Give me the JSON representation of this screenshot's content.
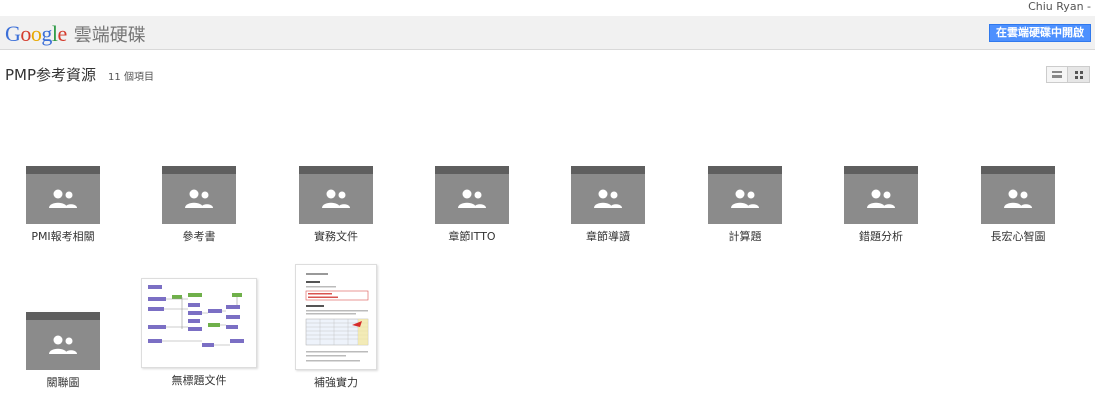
{
  "header": {
    "user_name": "Chiu Ryan -",
    "logo_letters": [
      "G",
      "o",
      "o",
      "g",
      "l",
      "e"
    ],
    "logo_colors": [
      "#3b6fd8",
      "#d43c2d",
      "#e8a800",
      "#3b6fd8",
      "#2f9b46",
      "#d43c2d"
    ],
    "product_name": "雲端硬碟",
    "open_button_label": "在雲端硬碟中開啟",
    "accent_color": "#4d90fe"
  },
  "folder": {
    "title": "PMP参考資源",
    "item_count": "11 個項目"
  },
  "view_toggle": {
    "list_icon": "list-view-icon",
    "grid_icon": "grid-view-icon",
    "active": "grid"
  },
  "items": [
    {
      "type": "shared-folder",
      "label": "PMI報考相關",
      "icon": "shared-folder-icon"
    },
    {
      "type": "shared-folder",
      "label": "參考書",
      "icon": "shared-folder-icon"
    },
    {
      "type": "shared-folder",
      "label": "實務文件",
      "icon": "shared-folder-icon"
    },
    {
      "type": "shared-folder",
      "label": "章節ITTO",
      "icon": "shared-folder-icon"
    },
    {
      "type": "shared-folder",
      "label": "章節導讀",
      "icon": "shared-folder-icon"
    },
    {
      "type": "shared-folder",
      "label": "計算題",
      "icon": "shared-folder-icon"
    },
    {
      "type": "shared-folder",
      "label": "錯題分析",
      "icon": "shared-folder-icon"
    },
    {
      "type": "shared-folder",
      "label": "長宏心智圖",
      "icon": "shared-folder-icon"
    },
    {
      "type": "shared-folder",
      "label": "關聯圖",
      "icon": "shared-folder-icon"
    },
    {
      "type": "document",
      "label": "無標題文件",
      "icon": "diagram-thumbnail"
    },
    {
      "type": "document",
      "label": "補強實力",
      "icon": "document-thumbnail"
    }
  ]
}
